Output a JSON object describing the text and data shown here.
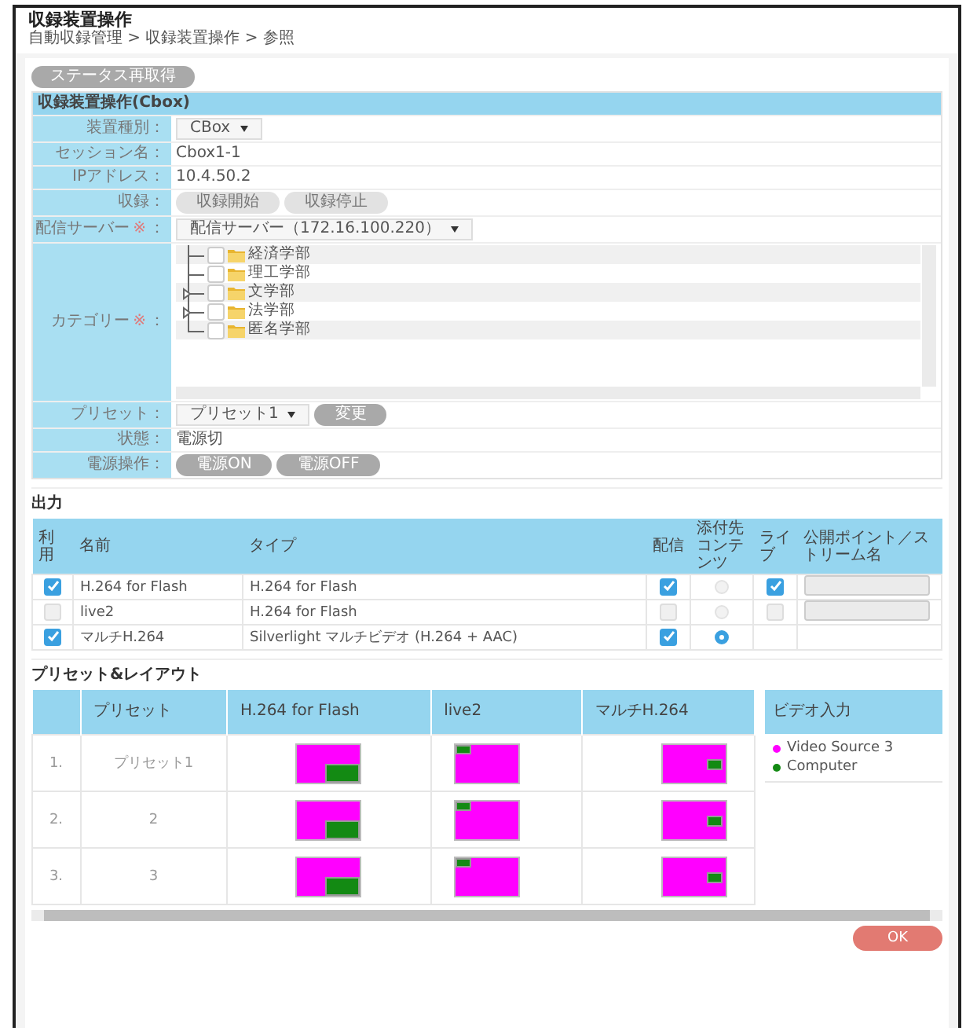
{
  "page": {
    "title": "収録装置操作",
    "breadcrumb": "自動収録管理 > 収録装置操作 > 参照"
  },
  "status_button": "ステータス再取得",
  "device_panel": {
    "title": "収録装置操作(Cbox)",
    "rows": [
      {
        "kind": "select",
        "label": "装置種別：",
        "value": "CBox"
      },
      {
        "kind": "text",
        "label": "セッション名：",
        "value": "Cbox1-1"
      },
      {
        "kind": "text",
        "label": "IPアドレス：",
        "value": "10.4.50.2"
      },
      {
        "kind": "buttons",
        "label": "収録：",
        "buttons": [
          {
            "label": "収録開始",
            "disabled": true
          },
          {
            "label": "収録停止",
            "disabled": true
          }
        ]
      },
      {
        "kind": "select",
        "label": "配信サーバー",
        "mark": "※",
        "tail": "：",
        "value": "配信サーバー（172.16.100.220）"
      },
      {
        "kind": "tree",
        "label": "カテゴリー",
        "mark": "※",
        "tail": "：",
        "items": [
          {
            "label": "経済学部",
            "checked": false,
            "expandable": false
          },
          {
            "label": "理工学部",
            "checked": false,
            "expandable": false
          },
          {
            "label": "文学部",
            "checked": false,
            "expandable": true
          },
          {
            "label": "法学部",
            "checked": false,
            "expandable": true
          },
          {
            "label": "匿名学部",
            "checked": false,
            "expandable": false
          }
        ]
      },
      {
        "kind": "select",
        "label": "プリセット：",
        "value": "プリセット1",
        "buttons": [
          {
            "label": "変更",
            "disabled": false
          }
        ]
      },
      {
        "kind": "text",
        "label": "状態：",
        "value": "電源切"
      },
      {
        "kind": "buttons",
        "label": "電源操作：",
        "buttons": [
          {
            "label": "電源ON",
            "disabled": false
          },
          {
            "label": "電源OFF",
            "disabled": false
          }
        ]
      }
    ]
  },
  "output": {
    "title": "出力",
    "columns": [
      "利用",
      "名前",
      "タイプ",
      "配信",
      "添付先コンテンツ",
      "ライブ",
      "公開ポイント／ストリーム名"
    ],
    "rows": [
      {
        "use": {
          "checked": true,
          "disabled": false
        },
        "name": "H.264 for Flash",
        "type": "H.264 for Flash",
        "distribute": {
          "checked": true,
          "disabled": false
        },
        "attach": {
          "selected": false,
          "disabled": true
        },
        "live": {
          "checked": true,
          "disabled": false
        },
        "publish_field": {
          "disabled": true
        }
      },
      {
        "use": {
          "checked": false,
          "disabled": true
        },
        "name": "live2",
        "type": "H.264 for Flash",
        "distribute": {
          "checked": false,
          "disabled": true
        },
        "attach": {
          "selected": false,
          "disabled": true
        },
        "live": {
          "checked": false,
          "disabled": true
        },
        "publish_field": {
          "disabled": true
        }
      },
      {
        "use": {
          "checked": true,
          "disabled": false
        },
        "name": "マルチH.264",
        "type": "Silverlight マルチビデオ (H.264 + AAC)",
        "distribute": {
          "checked": true,
          "disabled": false
        },
        "attach": {
          "selected": true,
          "disabled": false
        }
      }
    ]
  },
  "presets": {
    "title": "プリセット&レイアウト",
    "columns": [
      "プリセット",
      "H.264 for Flash",
      "live2",
      "マルチH.264"
    ],
    "rows": [
      {
        "number": "1.",
        "preset": "プリセット1",
        "layouts": [
          {
            "kind": "pip-bottom-right"
          },
          {
            "kind": "pip-top-left"
          },
          {
            "kind": "pip-right"
          }
        ]
      },
      {
        "number": "2.",
        "preset": "2",
        "layouts": [
          {
            "kind": "pip-bottom-right"
          },
          {
            "kind": "pip-top-left"
          },
          {
            "kind": "pip-right"
          }
        ]
      },
      {
        "number": "3.",
        "preset": "3",
        "layouts": [
          {
            "kind": "pip-bottom-right"
          },
          {
            "kind": "pip-top-left"
          },
          {
            "kind": "pip-right"
          }
        ]
      }
    ],
    "video_input": {
      "title": "ビデオ入力",
      "sources": [
        {
          "name": "Video Source 3",
          "color": "#ff00ff"
        },
        {
          "name": "Computer",
          "color": "#138a13"
        }
      ]
    }
  },
  "ok_button": "OK"
}
